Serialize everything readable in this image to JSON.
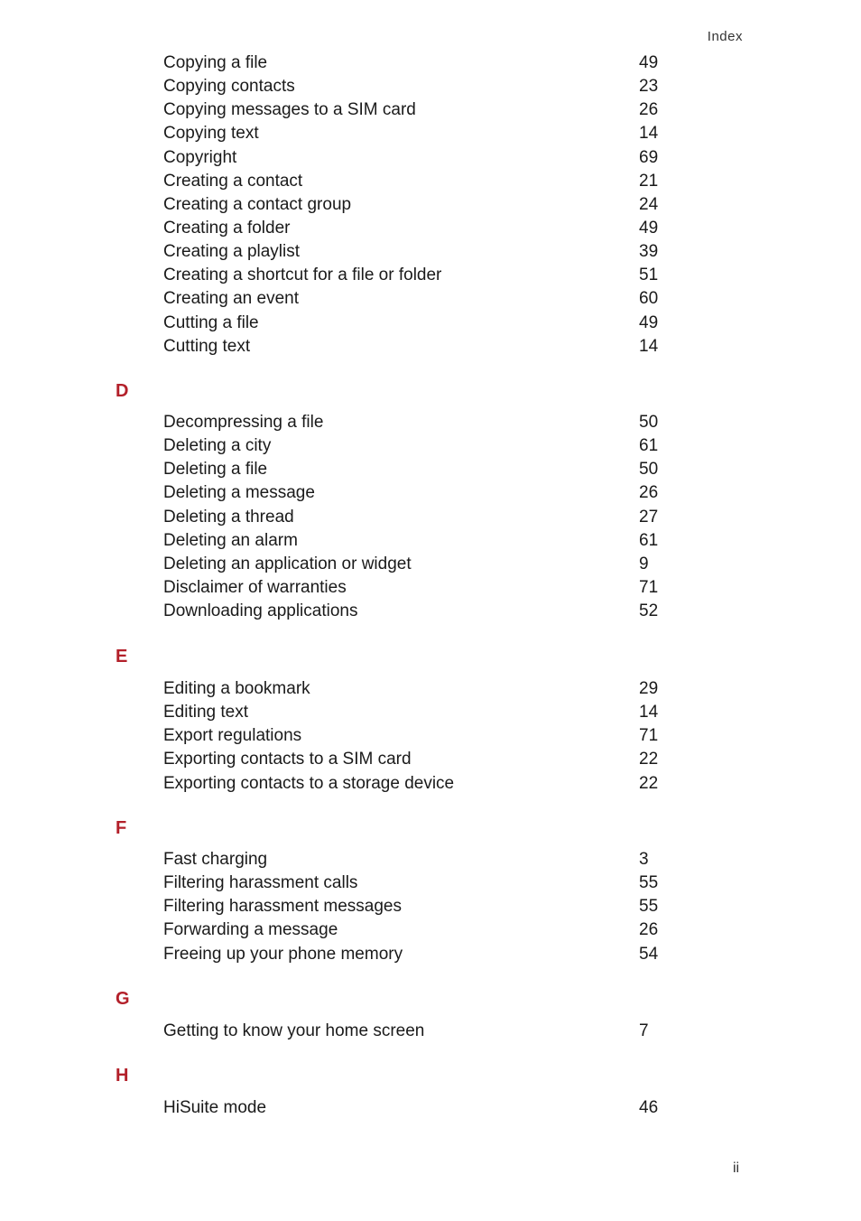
{
  "header": "Index",
  "footer": "ii",
  "accent_color": "#b3202a",
  "sections": [
    {
      "letter": "",
      "entries": [
        {
          "t": "Copying a file",
          "p": "49"
        },
        {
          "t": "Copying contacts",
          "p": "23"
        },
        {
          "t": "Copying messages to a SIM card",
          "p": "26"
        },
        {
          "t": "Copying text",
          "p": "14"
        },
        {
          "t": "Copyright",
          "p": "69"
        },
        {
          "t": "Creating a contact",
          "p": "21"
        },
        {
          "t": "Creating a contact group",
          "p": "24"
        },
        {
          "t": "Creating a folder",
          "p": "49"
        },
        {
          "t": "Creating a playlist",
          "p": "39"
        },
        {
          "t": "Creating a shortcut for a file or folder",
          "p": "51"
        },
        {
          "t": "Creating an event",
          "p": "60"
        },
        {
          "t": "Cutting a file",
          "p": "49"
        },
        {
          "t": "Cutting text",
          "p": "14"
        }
      ]
    },
    {
      "letter": "D",
      "entries": [
        {
          "t": "Decompressing a file",
          "p": "50"
        },
        {
          "t": "Deleting a city",
          "p": "61"
        },
        {
          "t": "Deleting a file",
          "p": "50"
        },
        {
          "t": "Deleting a message",
          "p": "26"
        },
        {
          "t": "Deleting a thread",
          "p": "27"
        },
        {
          "t": "Deleting an alarm",
          "p": "61"
        },
        {
          "t": "Deleting an application or widget",
          "p": "9"
        },
        {
          "t": "Disclaimer of warranties",
          "p": "71"
        },
        {
          "t": "Downloading applications",
          "p": "52"
        }
      ]
    },
    {
      "letter": "E",
      "entries": [
        {
          "t": "Editing a bookmark",
          "p": "29"
        },
        {
          "t": "Editing text",
          "p": "14"
        },
        {
          "t": "Export regulations",
          "p": "71"
        },
        {
          "t": "Exporting contacts to a SIM card",
          "p": "22"
        },
        {
          "t": "Exporting contacts to a storage device",
          "p": "22"
        }
      ]
    },
    {
      "letter": "F",
      "entries": [
        {
          "t": "Fast charging",
          "p": "3"
        },
        {
          "t": "Filtering harassment calls",
          "p": "55"
        },
        {
          "t": "Filtering harassment messages",
          "p": "55"
        },
        {
          "t": "Forwarding a message",
          "p": "26"
        },
        {
          "t": "Freeing up your phone memory",
          "p": "54"
        }
      ]
    },
    {
      "letter": "G",
      "entries": [
        {
          "t": "Getting to know your home screen",
          "p": "7"
        }
      ]
    },
    {
      "letter": "H",
      "entries": [
        {
          "t": "HiSuite mode",
          "p": "46"
        }
      ]
    }
  ]
}
